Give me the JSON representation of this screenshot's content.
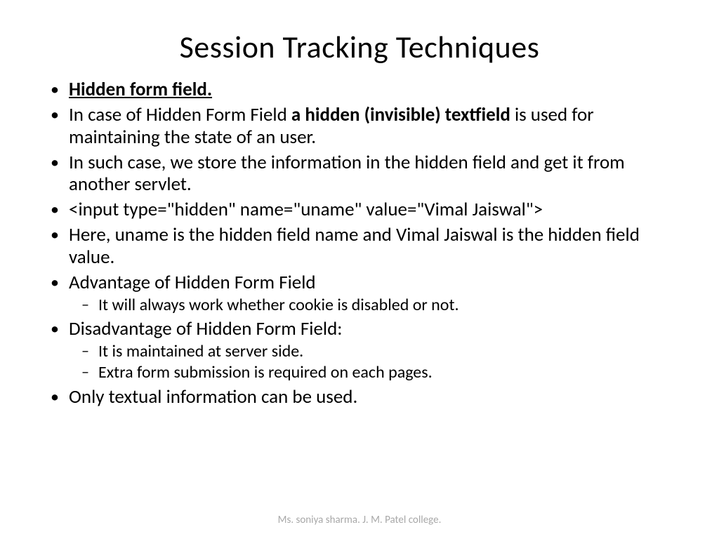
{
  "title": "Session Tracking Techniques",
  "bullets": {
    "b1": "Hidden form field.",
    "b2_pre": "In case of Hidden Form Field ",
    "b2_bold": "a hidden (invisible) textfield",
    "b2_post": " is used for maintaining the state of an user.",
    "b3": "In such case, we store the information in the hidden field and get it from another servlet.",
    "b4": "<input type=\"hidden\" name=\"uname\" value=\"Vimal Jaiswal\">",
    "b5": "Here, uname is the hidden field name and Vimal Jaiswal is the hidden field value.",
    "b6": "Advantage of Hidden Form Field",
    "b6_sub1": "It will always work whether cookie is disabled or not.",
    "b7": "Disadvantage of Hidden Form Field:",
    "b7_sub1": "It is maintained at server side.",
    "b7_sub2": "Extra form submission is required on each pages.",
    "b8": "Only textual information can be used."
  },
  "footer": "Ms. soniya sharma. J. M. Patel college."
}
